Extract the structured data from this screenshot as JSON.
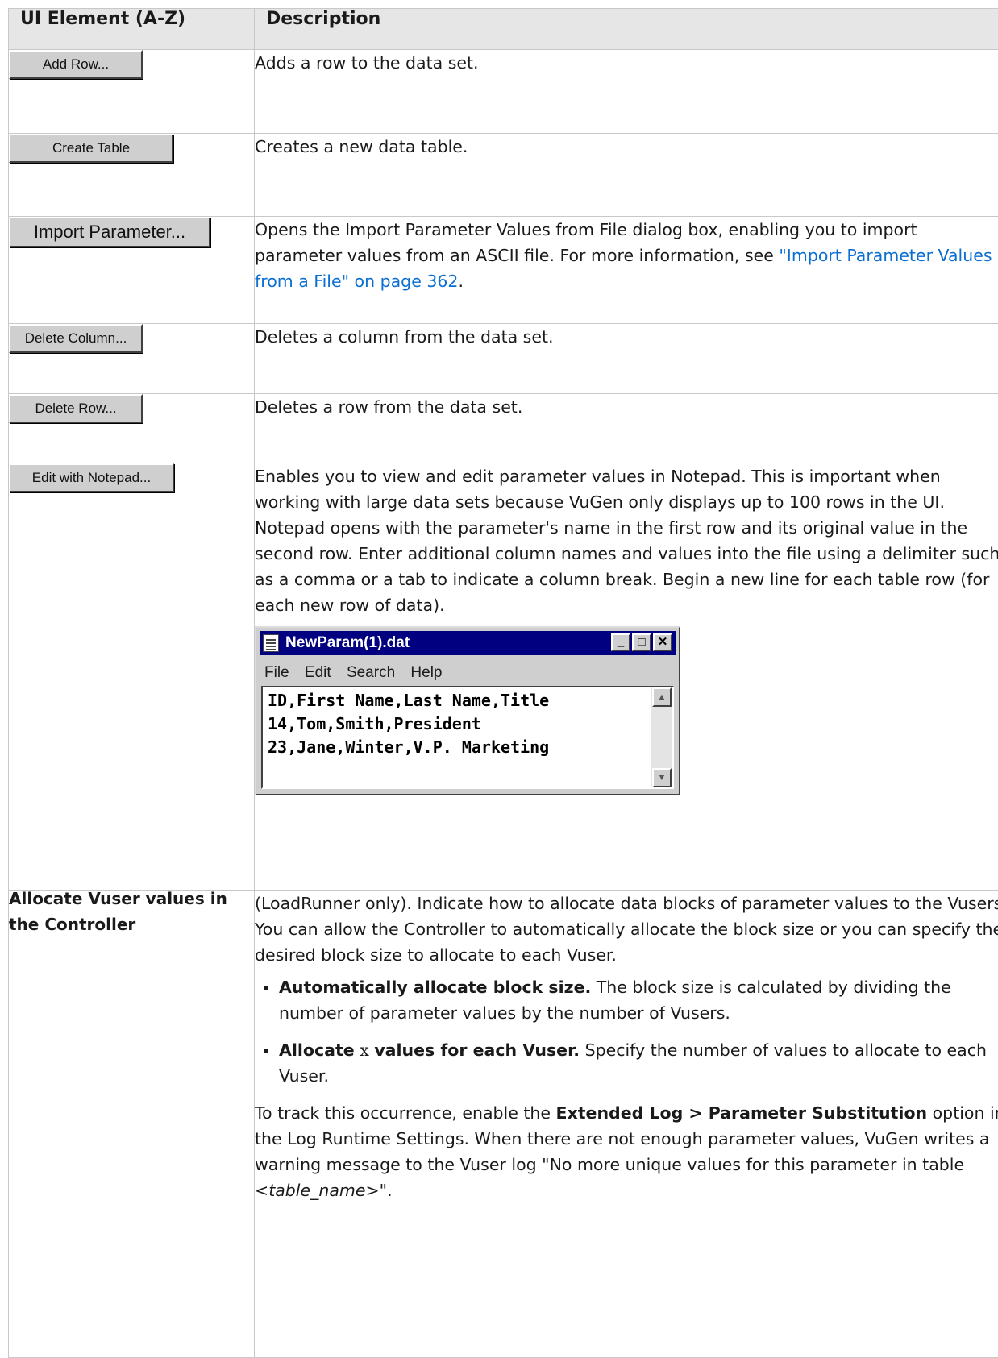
{
  "table": {
    "headers": [
      "UI Element (A-Z)",
      "Description"
    ],
    "rows": {
      "add_row": {
        "button": "Add Row...",
        "description": "Adds a row to the data set."
      },
      "create_table": {
        "button": "Create Table",
        "description": "Creates a new data table."
      },
      "import_parameter": {
        "button": "Import Parameter...",
        "description_pre": "Opens the Import Parameter Values from File dialog box, enabling you to import parameter values from an ASCII file. For more information, see ",
        "link": "\"Import Parameter Values from a File\" on page 362",
        "description_post": "."
      },
      "delete_column": {
        "button": "Delete Column...",
        "description": "Deletes a column from the data set."
      },
      "delete_row": {
        "button": "Delete Row...",
        "description": "Deletes a row from the data set."
      },
      "edit_notepad": {
        "button": "Edit with Notepad...",
        "description_1": "Enables you to view and edit parameter values in Notepad. This is important when working with large data sets because VuGen only displays up to 100 rows in the UI.",
        "description_2": "Notepad opens with the parameter's name in the first row and its original value in the second row. Enter additional column names and values into the file using a delimiter such as a comma or a tab to indicate a column break. Begin a new line for each table row (for each new row of data).",
        "notepad": {
          "title": "NewParam(1).dat",
          "menu": [
            "File",
            "Edit",
            "Search",
            "Help"
          ],
          "lines": [
            "ID,First Name,Last Name,Title",
            "14,Tom,Smith,President",
            "23,Jane,Winter,V.P. Marketing"
          ]
        }
      },
      "allocate": {
        "label": "Allocate Vuser values in the Controller",
        "intro": "(LoadRunner only). Indicate how to allocate data blocks of parameter values to the Vusers. You can allow the Controller to automatically allocate the block size or you can specify the desired block size to allocate to each Vuser.",
        "bullet_1_bold": "Automatically allocate block size.",
        "bullet_1_text": " The block size is calculated by dividing the number of parameter values by the number of Vusers.",
        "bullet_2_bold_a": "Allocate",
        "bullet_2_var": " x ",
        "bullet_2_bold_b": "values for each Vuser.",
        "bullet_2_text": " Specify the number of values to allocate to each Vuser.",
        "track_pre": "To track this occurrence, enable the ",
        "track_bold": "Extended Log > Parameter Substitution",
        "track_mid": " option in the Log Runtime Settings. When there are not enough parameter values, VuGen writes a warning message to the Vuser log \"No more unique values for this parameter in table <",
        "track_var": "table_name",
        "track_post": ">\"."
      }
    }
  }
}
